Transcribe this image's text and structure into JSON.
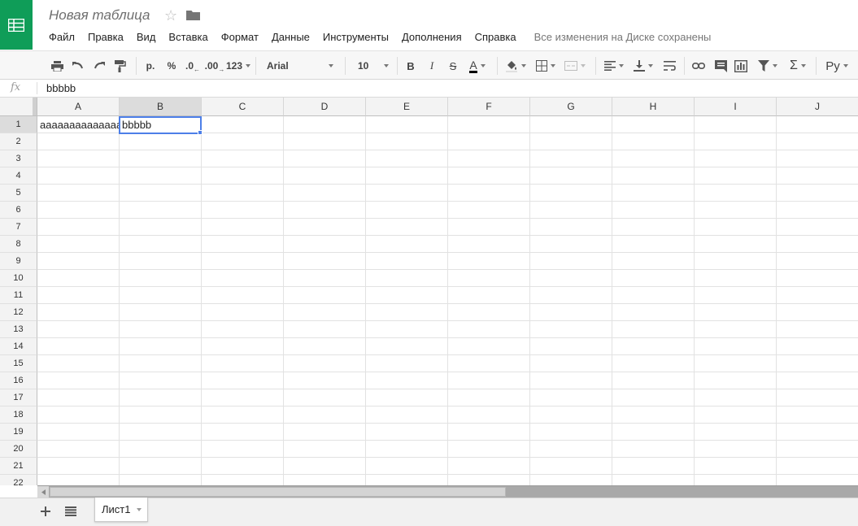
{
  "app": {
    "title": "Новая таблица",
    "save_status": "Все изменения на Диске сохранены",
    "brand_color": "#0f9d58"
  },
  "menu": [
    "Файл",
    "Правка",
    "Вид",
    "Вставка",
    "Формат",
    "Данные",
    "Инструменты",
    "Дополнения",
    "Справка"
  ],
  "toolbar": {
    "currency": "р.",
    "percent": "%",
    "dec_decrease": ".0",
    "dec_increase": ".00",
    "number_format": "123",
    "font_name": "Arial",
    "font_size": "10",
    "bold": "B",
    "italic": "I",
    "strike": "S",
    "text_color": "A",
    "function": "Σ",
    "input_tools": "Ру"
  },
  "formula_bar": {
    "fx_label": "fx",
    "value": "bbbbb"
  },
  "grid": {
    "columns": [
      "A",
      "B",
      "C",
      "D",
      "E",
      "F",
      "G",
      "H",
      "I",
      "J"
    ],
    "rows": [
      "1",
      "2",
      "3",
      "4",
      "5",
      "6",
      "7",
      "8",
      "9",
      "10",
      "11",
      "12",
      "13",
      "14",
      "15",
      "16",
      "17",
      "18",
      "19",
      "20",
      "21",
      "22"
    ],
    "cells": {
      "A1": "aaaaaaaaaaaaaa",
      "B1": "bbbbb"
    },
    "selected_cell": "B1",
    "selection_color": "#4d7fe8"
  },
  "sheets": [
    {
      "name": "Лист1"
    }
  ]
}
